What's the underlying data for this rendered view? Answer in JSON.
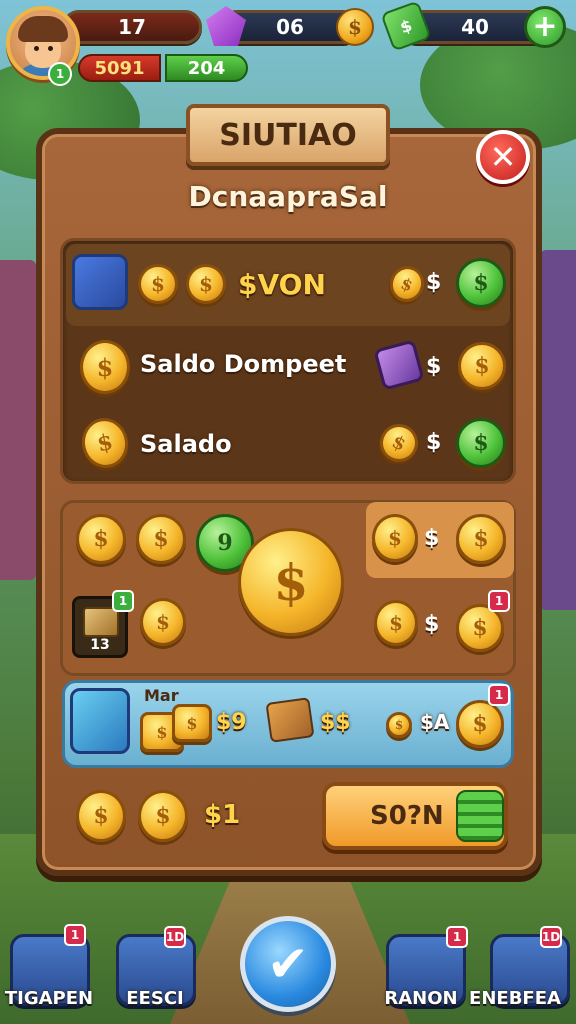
{
  "hud": {
    "level_count": "17",
    "gems": "06",
    "cash": "40",
    "coins_red": "5091",
    "cash_green": "204",
    "avatar_level": "1"
  },
  "dialog": {
    "banner_title": "SIUTIAO",
    "subtitle": "DcnaapraSal",
    "close_glyph": "✕"
  },
  "rows": {
    "row1_label": "$VON",
    "row1_price": "$",
    "row2_label": "Saldo Dompeet",
    "row2_price": "$",
    "row3_label": "Salado",
    "row3_price": "$"
  },
  "grid": {
    "coin_green_value": "9",
    "hl_price": "$",
    "chest_count": "13",
    "chest_badge": "1",
    "price_mid": "$",
    "mid_badge": "1"
  },
  "blue_row": {
    "tag": "Mar",
    "value_1": "$9",
    "value_2": "$$",
    "value_3": "$A",
    "badge": "1"
  },
  "bottom_row": {
    "price": "$1",
    "buy_label": "S0?N"
  },
  "nav": [
    {
      "label": "TIGAPEN",
      "badge": "1"
    },
    {
      "label": "EESCI",
      "badge": "1D"
    },
    {
      "label": "",
      "badge": ""
    },
    {
      "label": "RANON",
      "badge": "1"
    },
    {
      "label": "ENEBFEA",
      "badge": "1D"
    }
  ],
  "icons": {
    "center": "check-icon",
    "coin": "coin-icon"
  }
}
